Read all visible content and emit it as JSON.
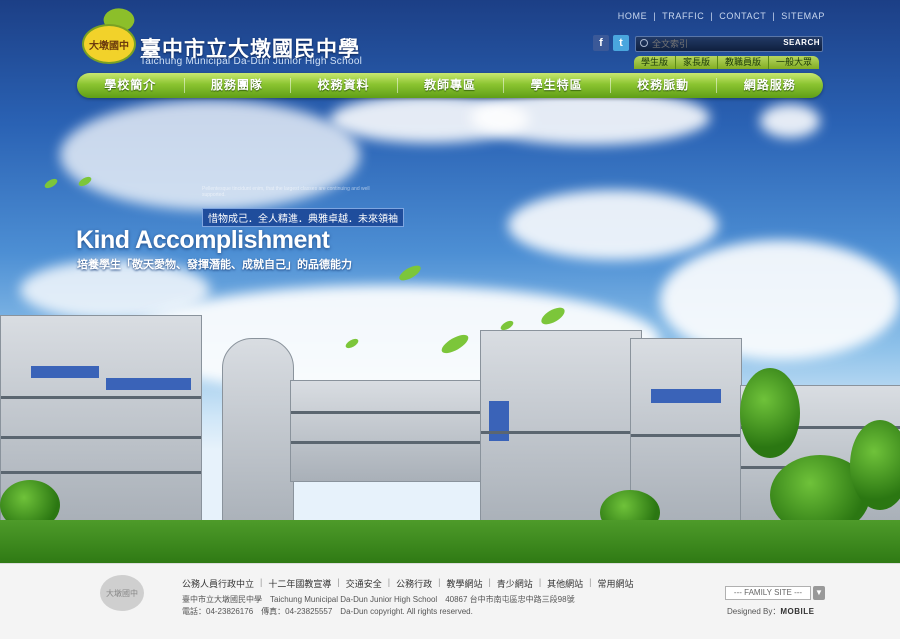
{
  "header": {
    "school_name": "臺中市立大墩國民中學",
    "school_name_en": "Taichung Municipal Da-Dun Junior High School",
    "logo_text": "大墩國中"
  },
  "toplinks": [
    "HOME",
    "TRAFFIC",
    "CONTACT",
    "SITEMAP"
  ],
  "search": {
    "placeholder": "全文索引",
    "button": "SEARCH"
  },
  "audience_tabs": [
    "學生版",
    "家長版",
    "教職員版",
    "一般大眾"
  ],
  "nav": [
    "學校簡介",
    "服務團隊",
    "校務資料",
    "教師專區",
    "學生特區",
    "校務脈動",
    "網路服務"
  ],
  "hero": {
    "tag": "惜物成己．全人精進．典雅卓越．未來領袖",
    "title": "Kind Accomplishment",
    "subtitle": "培養學生「敬天愛物、發揮潛能、成就自己」的品德能力",
    "fine_print": "Pellentesque tincidunt enim, that the largest classes are continuing and well supported."
  },
  "footer": {
    "logo_text": "大墩國中",
    "links": [
      "公務人員行政中立",
      "十二年國教宣導",
      "交通安全",
      "公務行政",
      "教學網站",
      "青少網站",
      "其他網站",
      "常用網站"
    ],
    "address_line": "臺中市立大墩國民中學　Taichung Municipal Da-Dun Junior High School　40867 台中市南屯區忠中路三段98號",
    "contact_line": "電話：04-23826176　傳真：04-23825557　Da-Dun copyright. All rights reserved.",
    "family_site": "--- FAMILY SITE ---",
    "designed_by_label": "Designed By：",
    "designer": "MOBILE"
  }
}
